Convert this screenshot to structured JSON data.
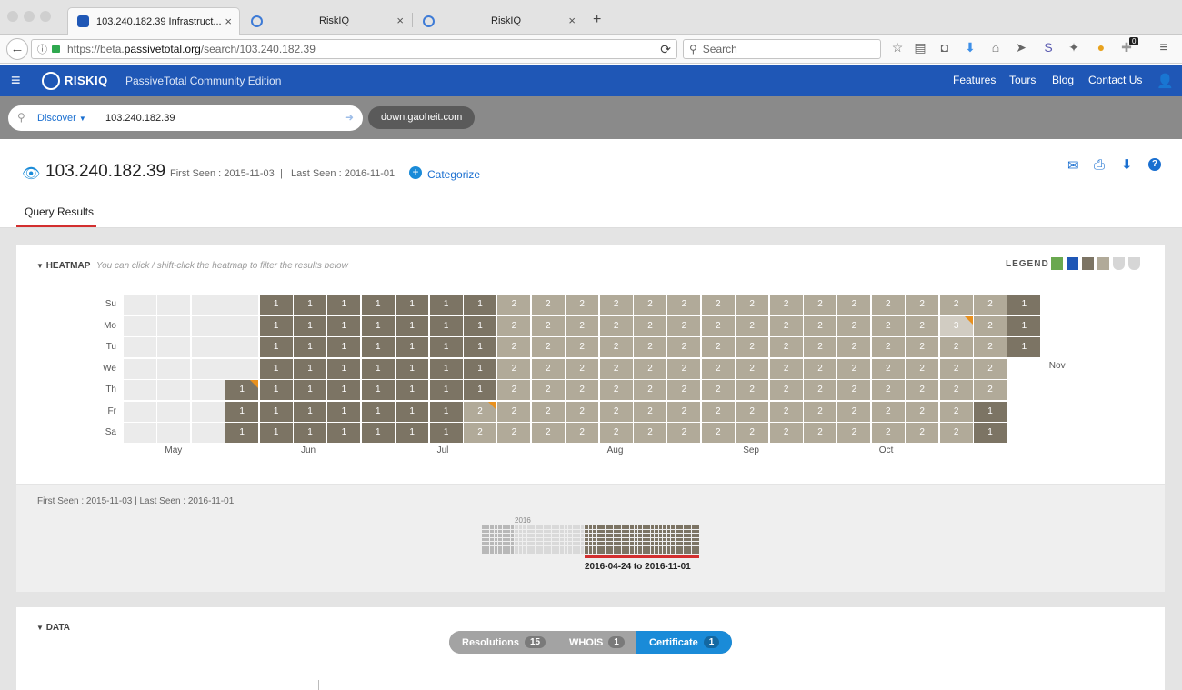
{
  "browser": {
    "tabs": [
      {
        "label": "103.240.182.39 Infrastruct...",
        "active": true
      },
      {
        "label": "RiskIQ",
        "active": false
      },
      {
        "label": "RiskIQ",
        "active": false
      }
    ],
    "new_tab": "+",
    "url_prefix": "https://beta.",
    "url_host": "passivetotal.org",
    "url_path": "/search/103.240.182.39",
    "search_placeholder": "Search",
    "notif_count": "0"
  },
  "app": {
    "brand": "RISKIQ",
    "edition": "PassiveTotal Community Edition",
    "nav": [
      "Features",
      "Tours",
      "Blog",
      "Contact Us"
    ]
  },
  "search": {
    "mode": "Discover",
    "query": "103.240.182.39",
    "related_chip": "down.gaoheit.com"
  },
  "result": {
    "ip": "103.240.182.39",
    "first_seen": "First Seen : 2015-11-03",
    "separator": "|",
    "last_seen": "Last Seen : 2016-11-01",
    "categorize": "Categorize",
    "tab": "Query Results"
  },
  "heatmap": {
    "title": "HEATMAP",
    "hint": "You can click / shift-click the heatmap to filter the results below",
    "legend_label": "LEGEND",
    "legend_colors": [
      "#6aa84f",
      "#1f57b6",
      "#7c7464",
      "#b1aa99",
      "#d6d6d6",
      "#d6d6d6"
    ],
    "days": [
      "Su",
      "Mo",
      "Tu",
      "We",
      "Th",
      "Fr",
      "Sa"
    ],
    "months": [
      {
        "label": "May",
        "week": 1
      },
      {
        "label": "Jun",
        "week": 5
      },
      {
        "label": "Jul",
        "week": 9
      },
      {
        "label": "Aug",
        "week": 14
      },
      {
        "label": "Sep",
        "week": 18
      },
      {
        "label": "Oct",
        "week": 22
      },
      {
        "label": "Nov",
        "week": 27
      }
    ],
    "weeks": [
      [
        "",
        "",
        "",
        "",
        "",
        "",
        ""
      ],
      [
        "",
        "",
        "",
        "",
        "",
        "",
        ""
      ],
      [
        "",
        "",
        "",
        "",
        "",
        "",
        ""
      ],
      [
        "",
        "",
        "",
        "",
        "1",
        "1",
        "1"
      ],
      [
        "1",
        "1",
        "1",
        "1",
        "1",
        "1",
        "1"
      ],
      [
        "1",
        "1",
        "1",
        "1",
        "1",
        "1",
        "1"
      ],
      [
        "1",
        "1",
        "1",
        "1",
        "1",
        "1",
        "1"
      ],
      [
        "1",
        "1",
        "1",
        "1",
        "1",
        "1",
        "1"
      ],
      [
        "1",
        "1",
        "1",
        "1",
        "1",
        "1",
        "1"
      ],
      [
        "1",
        "1",
        "1",
        "1",
        "1",
        "1",
        "1"
      ],
      [
        "1",
        "1",
        "1",
        "1",
        "1",
        "2",
        "2"
      ],
      [
        "2",
        "2",
        "2",
        "2",
        "2",
        "2",
        "2"
      ],
      [
        "2",
        "2",
        "2",
        "2",
        "2",
        "2",
        "2"
      ],
      [
        "2",
        "2",
        "2",
        "2",
        "2",
        "2",
        "2"
      ],
      [
        "2",
        "2",
        "2",
        "2",
        "2",
        "2",
        "2"
      ],
      [
        "2",
        "2",
        "2",
        "2",
        "2",
        "2",
        "2"
      ],
      [
        "2",
        "2",
        "2",
        "2",
        "2",
        "2",
        "2"
      ],
      [
        "2",
        "2",
        "2",
        "2",
        "2",
        "2",
        "2"
      ],
      [
        "2",
        "2",
        "2",
        "2",
        "2",
        "2",
        "2"
      ],
      [
        "2",
        "2",
        "2",
        "2",
        "2",
        "2",
        "2"
      ],
      [
        "2",
        "2",
        "2",
        "2",
        "2",
        "2",
        "2"
      ],
      [
        "2",
        "2",
        "2",
        "2",
        "2",
        "2",
        "2"
      ],
      [
        "2",
        "2",
        "2",
        "2",
        "2",
        "2",
        "2"
      ],
      [
        "2",
        "2",
        "2",
        "2",
        "2",
        "2",
        "2"
      ],
      [
        "2",
        "3",
        "2",
        "2",
        "2",
        "2",
        "2"
      ],
      [
        "2",
        "2",
        "2",
        "2",
        "2",
        "1",
        "1"
      ],
      [
        "1",
        "1",
        "1",
        "",
        "",
        "",
        ""
      ]
    ],
    "flagged": [
      [
        3,
        4
      ],
      [
        10,
        5
      ],
      [
        24,
        1
      ]
    ]
  },
  "timeline": {
    "summary": "First Seen : 2015-11-03 | Last Seen : 2016-11-01",
    "year": "2016",
    "range": "2016-04-24 to 2016-11-01"
  },
  "data_section": {
    "title": "DATA",
    "pills": [
      {
        "label": "Resolutions",
        "count": "15",
        "color": "#a3a3a3"
      },
      {
        "label": "WHOIS",
        "count": "1",
        "color": "#a3a3a3"
      },
      {
        "label": "Certificate",
        "count": "1",
        "color": "#1a8bd8"
      }
    ]
  }
}
